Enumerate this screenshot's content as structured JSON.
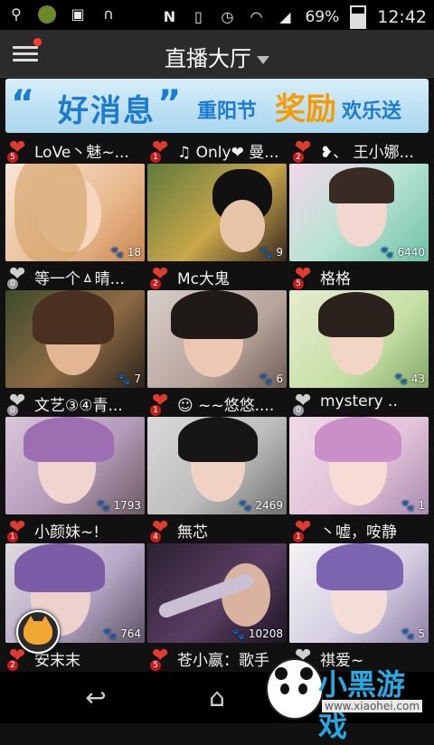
{
  "status_bar": {
    "battery": "69%",
    "time": "12:42"
  },
  "header": {
    "title": "直播大厅"
  },
  "banner": {
    "left_quote": "“",
    "part1": "好消息",
    "right_quote": "”",
    "part2": "重阳节",
    "part3": "奖励",
    "part4": "欢乐送"
  },
  "rows": [
    {
      "names": [
        {
          "badge": "5",
          "name": "LoVe丶魅~...",
          "heart": "red"
        },
        {
          "badge": "1",
          "name": "♫ Only❤ 曼...",
          "heart": "red"
        },
        {
          "badge": "2",
          "name": "❥、 王小娜...",
          "heart": "red"
        }
      ],
      "counts": [
        "18",
        "9",
        "6440"
      ]
    },
    {
      "names": [
        {
          "badge": "0",
          "name": "等一个ㅿ晴...",
          "heart": "grey"
        },
        {
          "badge": "2",
          "name": "Mc大鬼",
          "heart": "red"
        },
        {
          "badge": "5",
          "name": "格格",
          "heart": "red"
        }
      ],
      "counts": [
        "7",
        "6",
        "43"
      ]
    },
    {
      "names": [
        {
          "badge": "0",
          "name": "文艺③④青...",
          "heart": "grey"
        },
        {
          "badge": "1",
          "name": "☺ ~~悠悠....",
          "heart": "red"
        },
        {
          "badge": "0",
          "name": "mystery ..",
          "heart": "grey"
        }
      ],
      "counts": [
        "1793",
        "2469",
        "1"
      ]
    },
    {
      "names": [
        {
          "badge": "1",
          "name": "小颜妹~!",
          "heart": "red"
        },
        {
          "badge": "4",
          "name": "無芯",
          "heart": "red"
        },
        {
          "badge": "1",
          "name": "丶嘘，咹静",
          "heart": "red"
        }
      ],
      "counts": [
        "764",
        "10208",
        "5"
      ]
    },
    {
      "names": [
        {
          "badge": "2",
          "name": "安末末",
          "heart": "red"
        },
        {
          "badge": "5",
          "name": "苍小嬴：歌手",
          "heart": "red"
        },
        {
          "badge": "0",
          "name": "祺爱~",
          "heart": "grey"
        }
      ],
      "counts": []
    }
  ],
  "watermark": {
    "brand": "小黑游戏",
    "url": "www.xiaohei.com"
  }
}
